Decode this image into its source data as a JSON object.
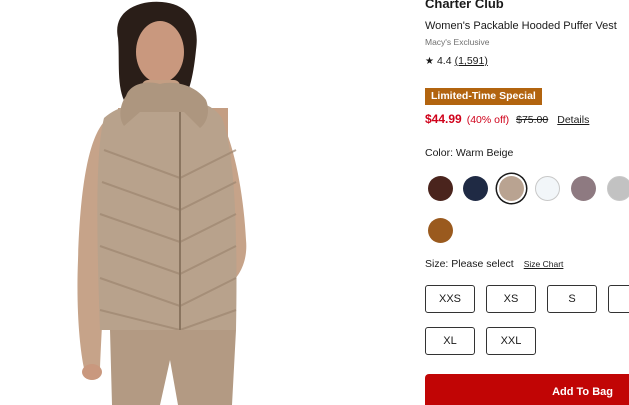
{
  "product": {
    "brand": "Charter Club",
    "title": "Women's Packable Hooded Puffer Vest",
    "exclusive": "Macy's Exclusive",
    "rating": "4.4",
    "reviews": "(1,591)",
    "promo_badge": "Limited-Time Special",
    "sale_price": "$44.99",
    "discount": "(40% off)",
    "original_price": "$75.00",
    "details_link": "Details"
  },
  "colors": {
    "label": "Color: Warm Beige",
    "swatches": [
      {
        "name": "brown-swatch",
        "color": "#4a241d"
      },
      {
        "name": "navy-swatch",
        "color": "#1f2a44"
      },
      {
        "name": "warm-beige-swatch",
        "color": "#b9a391",
        "selected": true
      },
      {
        "name": "white-swatch",
        "color": "#f2f6f9"
      },
      {
        "name": "mauve-swatch",
        "color": "#8e7a81"
      },
      {
        "name": "gray-swatch",
        "color": "#c2c2c2"
      },
      {
        "name": "cognac-swatch",
        "color": "#9a5a1e"
      }
    ]
  },
  "sizes": {
    "label": "Size: Please select",
    "size_chart": "Size Chart",
    "options": [
      "XXS",
      "XS",
      "S",
      "",
      "XL",
      "XXL"
    ]
  },
  "actions": {
    "add_to_bag": "Add To Bag"
  },
  "icons": {
    "rating": "star-icon"
  }
}
